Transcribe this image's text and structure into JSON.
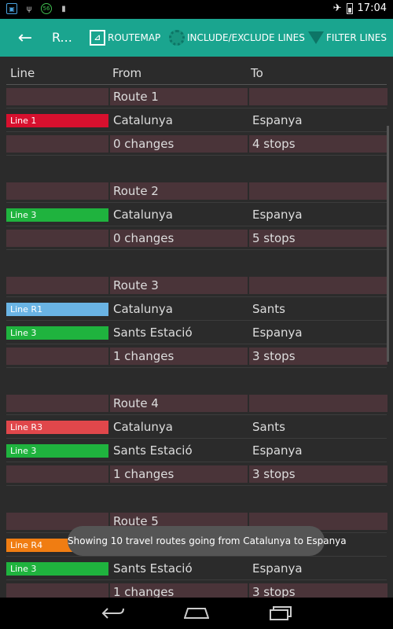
{
  "status_bar": {
    "time": "17:04",
    "left_icons": [
      "notification-icon",
      "usb-icon",
      "sync-icon",
      "storage-icon"
    ],
    "right_icons": [
      "airplane-mode-icon",
      "battery-icon"
    ]
  },
  "action_bar": {
    "title": "R...",
    "routemap_label": "ROUTEMAP",
    "include_label": "INCLUDE/EXCLUDE LINES",
    "filter_label": "FILTER LINES",
    "color": "#1aa58f"
  },
  "table": {
    "headers": {
      "line": "Line",
      "from": "From",
      "to": "To"
    },
    "routes": [
      {
        "title": "Route 1",
        "legs": [
          {
            "line": "Line 1",
            "color": "#d7102e",
            "from": "Catalunya",
            "to": "Espanya"
          }
        ],
        "changes": "0 changes",
        "stops": "4 stops"
      },
      {
        "title": "Route 2",
        "legs": [
          {
            "line": "Line 3",
            "color": "#1fb33e",
            "from": "Catalunya",
            "to": "Espanya"
          }
        ],
        "changes": "0 changes",
        "stops": "5 stops"
      },
      {
        "title": "Route 3",
        "legs": [
          {
            "line": "Line R1",
            "color": "#6ab4e4",
            "from": "Catalunya",
            "to": "Sants"
          },
          {
            "line": "Line 3",
            "color": "#1fb33e",
            "from": "Sants Estació",
            "to": "Espanya"
          }
        ],
        "changes": "1 changes",
        "stops": "3 stops"
      },
      {
        "title": "Route 4",
        "legs": [
          {
            "line": "Line R3",
            "color": "#e0474b",
            "from": "Catalunya",
            "to": "Sants"
          },
          {
            "line": "Line 3",
            "color": "#1fb33e",
            "from": "Sants Estació",
            "to": "Espanya"
          }
        ],
        "changes": "1 changes",
        "stops": "3 stops"
      },
      {
        "title": "Route 5",
        "legs": [
          {
            "line": "Line R4",
            "color": "#f07d12",
            "from": "",
            "to": ""
          },
          {
            "line": "Line 3",
            "color": "#1fb33e",
            "from": "Sants Estació",
            "to": "Espanya"
          }
        ],
        "changes": "1 changes",
        "stops": "3 stops"
      }
    ]
  },
  "toast": {
    "text": "Showing 10 travel routes going from Catalunya to Espanya"
  }
}
